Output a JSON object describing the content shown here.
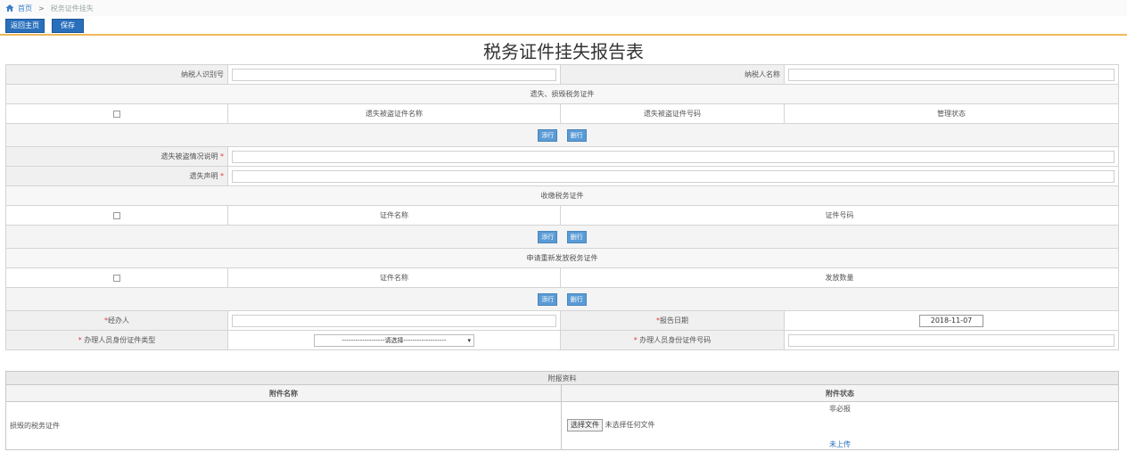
{
  "breadcrumb": {
    "home": "首页",
    "separator": ">",
    "current": "税务证件挂失",
    "home_icon": "home-icon"
  },
  "toolbar": {
    "back_label": "返回主页",
    "save_label": "保存"
  },
  "page_title": "税务证件挂失报告表",
  "taxpayer": {
    "id_label": "纳税人识别号",
    "id_value": "",
    "name_label": "纳税人名称",
    "name_value": ""
  },
  "lost_section": {
    "title": "遗失、损毁税务证件",
    "columns": [
      "遗失被盗证件名称",
      "遗失被盗证件号码",
      "管理状态"
    ],
    "add_label": "添行",
    "delete_label": "删行",
    "desc_label": "遗失被盗情况说明",
    "statement_label": "遗失声明",
    "required_mark": "*"
  },
  "collect_section": {
    "title": "收缴税务证件",
    "columns": [
      "证件名称",
      "证件号码"
    ],
    "add_label": "添行",
    "delete_label": "删行"
  },
  "reissue_section": {
    "title": "申请重新发放税务证件",
    "columns": [
      "证件名称",
      "发放数量"
    ],
    "add_label": "添行",
    "delete_label": "删行"
  },
  "handler": {
    "handler_label": "经办人",
    "date_label": "报告日期",
    "date_value": "2018-11-07",
    "id_type_label": "办理人员身份证件类型",
    "id_type_value": "-------------------请选择-------------------",
    "id_no_label": "办理人员身份证件号码",
    "required_mark": "*"
  },
  "attachments": {
    "title": "附报资料",
    "col_name": "附件名称",
    "col_status": "附件状态",
    "rows": [
      {
        "name": "损毁的税务证件",
        "requirement": "非必报",
        "choose_label": "选择文件",
        "no_file_label": "未选择任何文件",
        "upload_status": "未上传"
      }
    ]
  }
}
